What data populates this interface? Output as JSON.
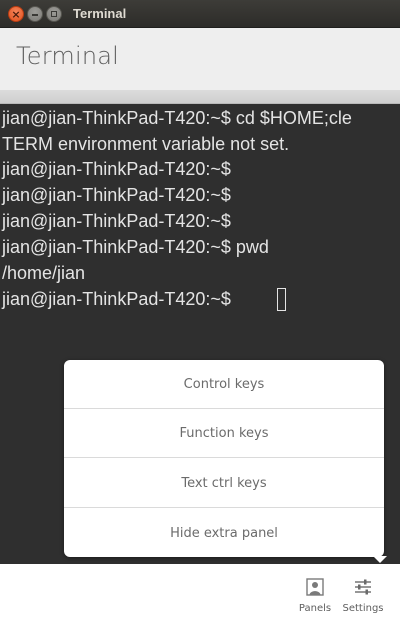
{
  "window": {
    "title": "Terminal",
    "close_glyph": "×"
  },
  "header": {
    "title": "Terminal"
  },
  "terminal": {
    "lines": [
      "jian@jian-ThinkPad-T420:~$ cd $HOME;cle",
      "TERM environment variable not set.",
      "jian@jian-ThinkPad-T420:~$",
      "jian@jian-ThinkPad-T420:~$",
      "jian@jian-ThinkPad-T420:~$",
      "jian@jian-ThinkPad-T420:~$ pwd",
      "/home/jian",
      "jian@jian-ThinkPad-T420:~$"
    ]
  },
  "popup": {
    "items": [
      "Control keys",
      "Function keys",
      "Text ctrl keys",
      "Hide extra panel"
    ]
  },
  "toolbar": {
    "panels": {
      "label": "Panels",
      "icon": "panels-icon"
    },
    "settings": {
      "label": "Settings",
      "icon": "settings-icon"
    }
  },
  "colors": {
    "terminal_bg": "#2f2f2f",
    "terminal_fg": "#e4e4e4",
    "close_button": "#e0501c",
    "header_bg": "#eeeeee"
  }
}
